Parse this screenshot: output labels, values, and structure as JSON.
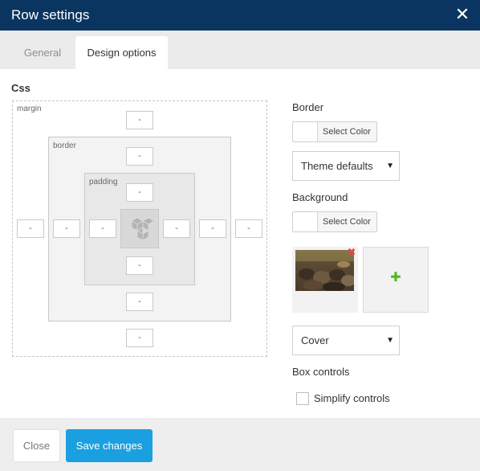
{
  "dialog": {
    "title": "Row settings"
  },
  "tabs": [
    {
      "label": "General",
      "active": false
    },
    {
      "label": "Design options",
      "active": true
    }
  ],
  "css_section": {
    "label": "Css",
    "margin_label": "margin",
    "border_label": "border",
    "padding_label": "padding",
    "margin": {
      "top": "-",
      "right": "-",
      "bottom": "-",
      "left": "-"
    },
    "border": {
      "top": "-",
      "right": "-",
      "bottom": "-",
      "left": "-"
    },
    "padding": {
      "top": "-",
      "right": "-",
      "bottom": "-",
      "left": "-"
    }
  },
  "border_section": {
    "label": "Border",
    "color_button": "Select Color",
    "style_select": "Theme defaults"
  },
  "background_section": {
    "label": "Background",
    "color_button": "Select Color",
    "size_select": "Cover"
  },
  "box_controls": {
    "label": "Box controls",
    "simplify_label": "Simplify controls",
    "simplify_checked": false
  },
  "footer": {
    "close_label": "Close",
    "save_label": "Save changes"
  },
  "colors": {
    "titlebar": "#0a3560",
    "save_button": "#1aa0e0",
    "remove_icon": "#e04a3c",
    "add_icon": "#4fb81f"
  }
}
